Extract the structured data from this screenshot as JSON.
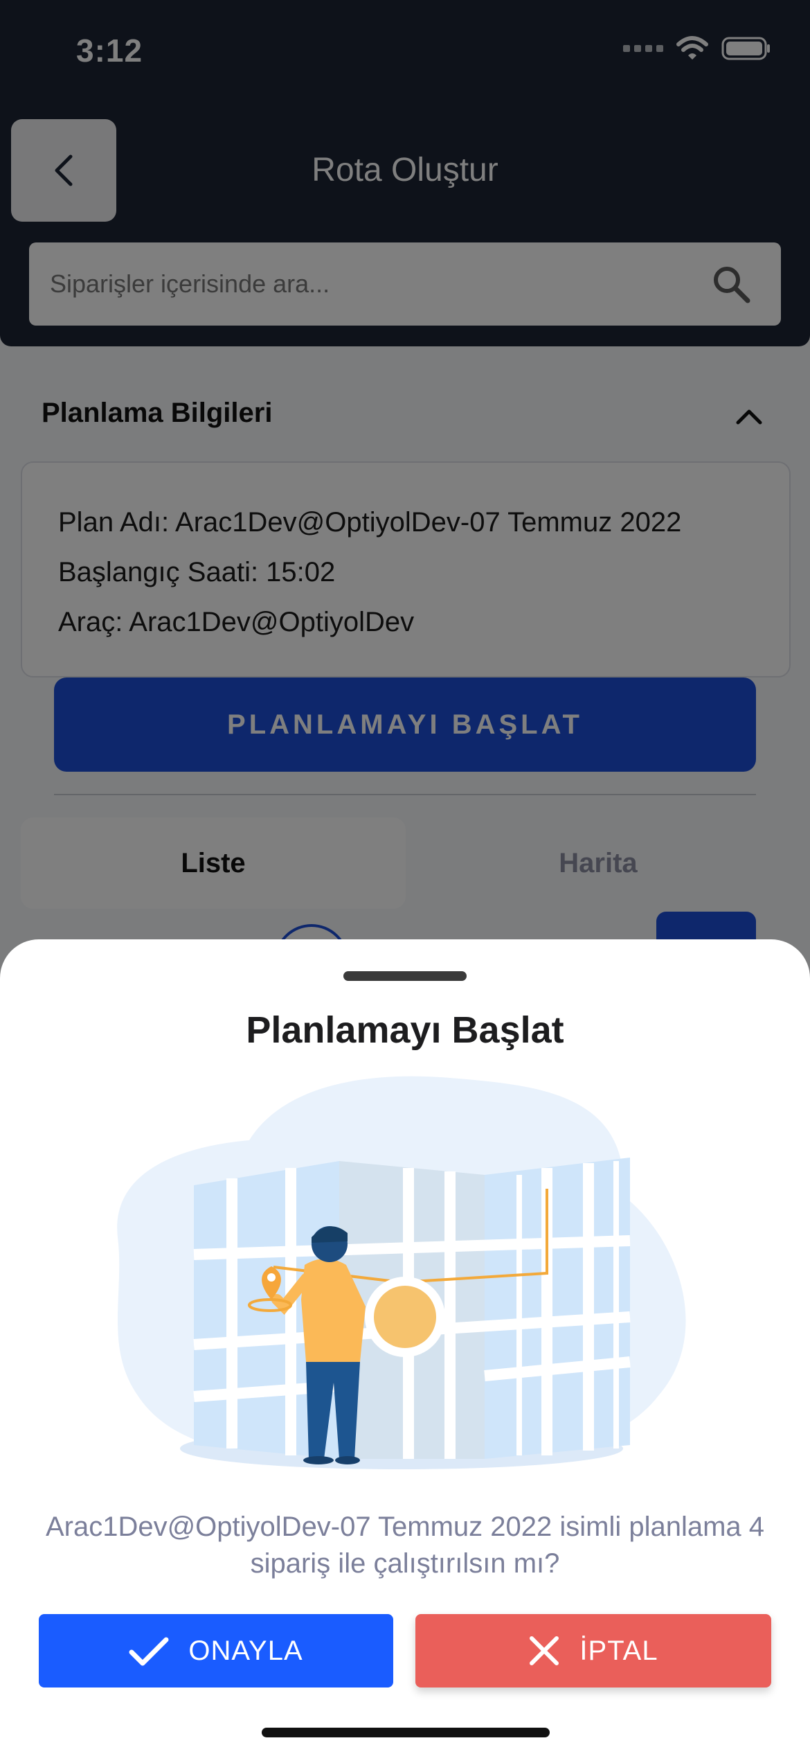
{
  "status_bar": {
    "time": "3:12"
  },
  "header": {
    "title": "Rota Oluştur",
    "search_placeholder": "Siparişler içerisinde ara..."
  },
  "planning_section": {
    "title": "Planlama Bilgileri",
    "plan_name": "Plan Adı: Arac1Dev@OptiyolDev-07 Temmuz 2022",
    "start_time": "Başlangıç Saati: 15:02",
    "vehicle": "Araç: Arac1Dev@OptiyolDev",
    "start_button_label": "PLANLAMAYI BAŞLAT"
  },
  "tabs": [
    {
      "label": "Liste",
      "selected": true
    },
    {
      "label": "Harita",
      "selected": false
    }
  ],
  "sheet": {
    "title": "Planlamayı Başlat",
    "message": "Arac1Dev@OptiyolDev-07 Temmuz 2022 isimli planlama 4 sipariş ile çalıştırılsın mı?",
    "confirm_label": "ONAYLA",
    "cancel_label": "İPTAL"
  },
  "colors": {
    "header_bg": "#1c2434",
    "primary": "#1d4fd8",
    "confirm": "#1a5cff",
    "cancel": "#ea5f5a"
  },
  "icons": [
    "back-chevron-icon",
    "search-icon",
    "chevron-up-icon",
    "check-icon",
    "close-icon",
    "wifi-icon",
    "battery-icon",
    "cellular-signal-icon"
  ]
}
